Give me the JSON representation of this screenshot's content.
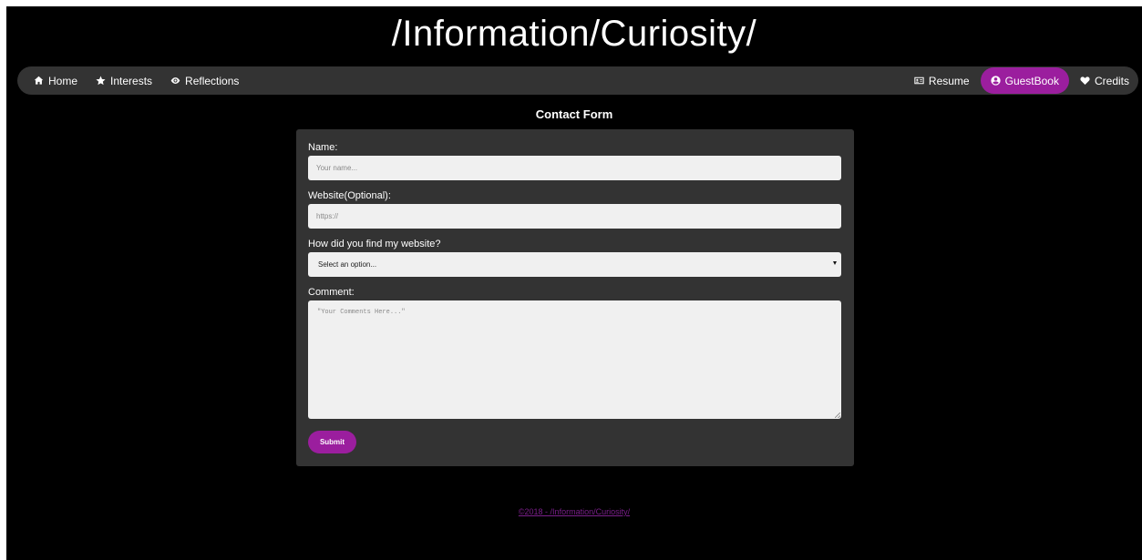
{
  "header": {
    "title": "/Information/Curiosity/"
  },
  "nav": {
    "left": [
      {
        "label": "Home",
        "icon": "home-icon"
      },
      {
        "label": "Interests",
        "icon": "star-icon"
      },
      {
        "label": "Reflections",
        "icon": "eye-icon"
      }
    ],
    "right": [
      {
        "label": "Resume",
        "icon": "id-card-icon"
      },
      {
        "label": "GuestBook",
        "icon": "user-circle-icon",
        "active": true
      },
      {
        "label": "Credits",
        "icon": "heart-icon"
      }
    ],
    "active_color": "#9b1e9e"
  },
  "form": {
    "heading": "Contact Form",
    "name_label": "Name:",
    "name_placeholder": "Your name...",
    "website_label": "Website(Optional):",
    "website_placeholder": "https://",
    "source_label": "How did you find my website?",
    "source_selected": "Select an option...",
    "comment_label": "Comment:",
    "comment_placeholder": "\"Your Comments Here...\"",
    "submit_label": "Submit"
  },
  "footer": {
    "text": "©2018 - /Information/Curiosity/"
  },
  "colors": {
    "background": "#000000",
    "panel": "#333333",
    "accent": "#9b1e9e",
    "footer_link": "#7a1f8a"
  }
}
